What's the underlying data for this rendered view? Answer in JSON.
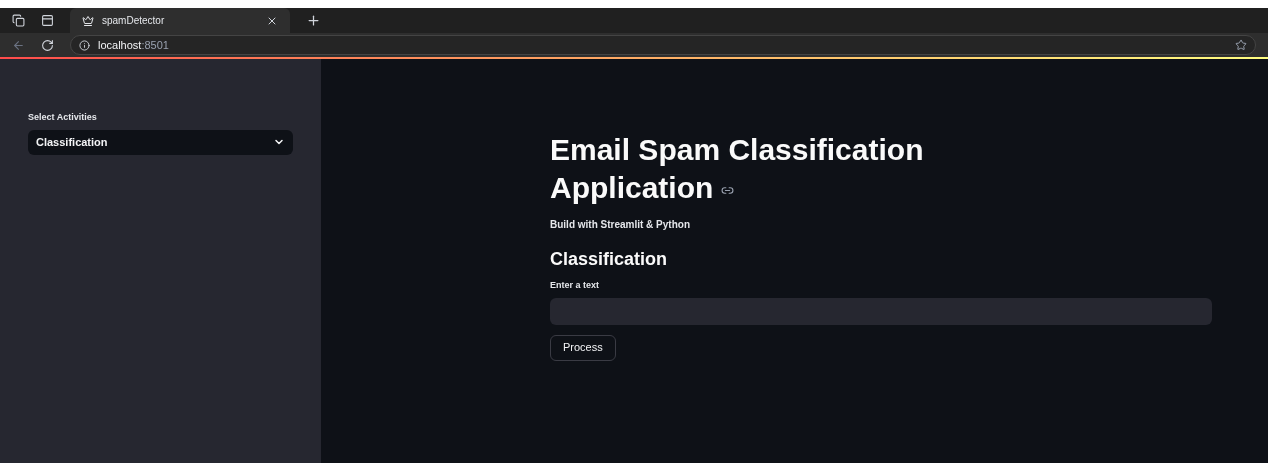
{
  "browser": {
    "tab_title": "spamDetector",
    "url_host": "localhost",
    "url_port": ":8501"
  },
  "sidebar": {
    "select_label": "Select Activities",
    "select_value": "Classification"
  },
  "main": {
    "title": "Email Spam Classification Application",
    "subtitle": "Build with Streamlit & Python",
    "section_heading": "Classification",
    "input_label": "Enter a text",
    "button": "Process"
  }
}
